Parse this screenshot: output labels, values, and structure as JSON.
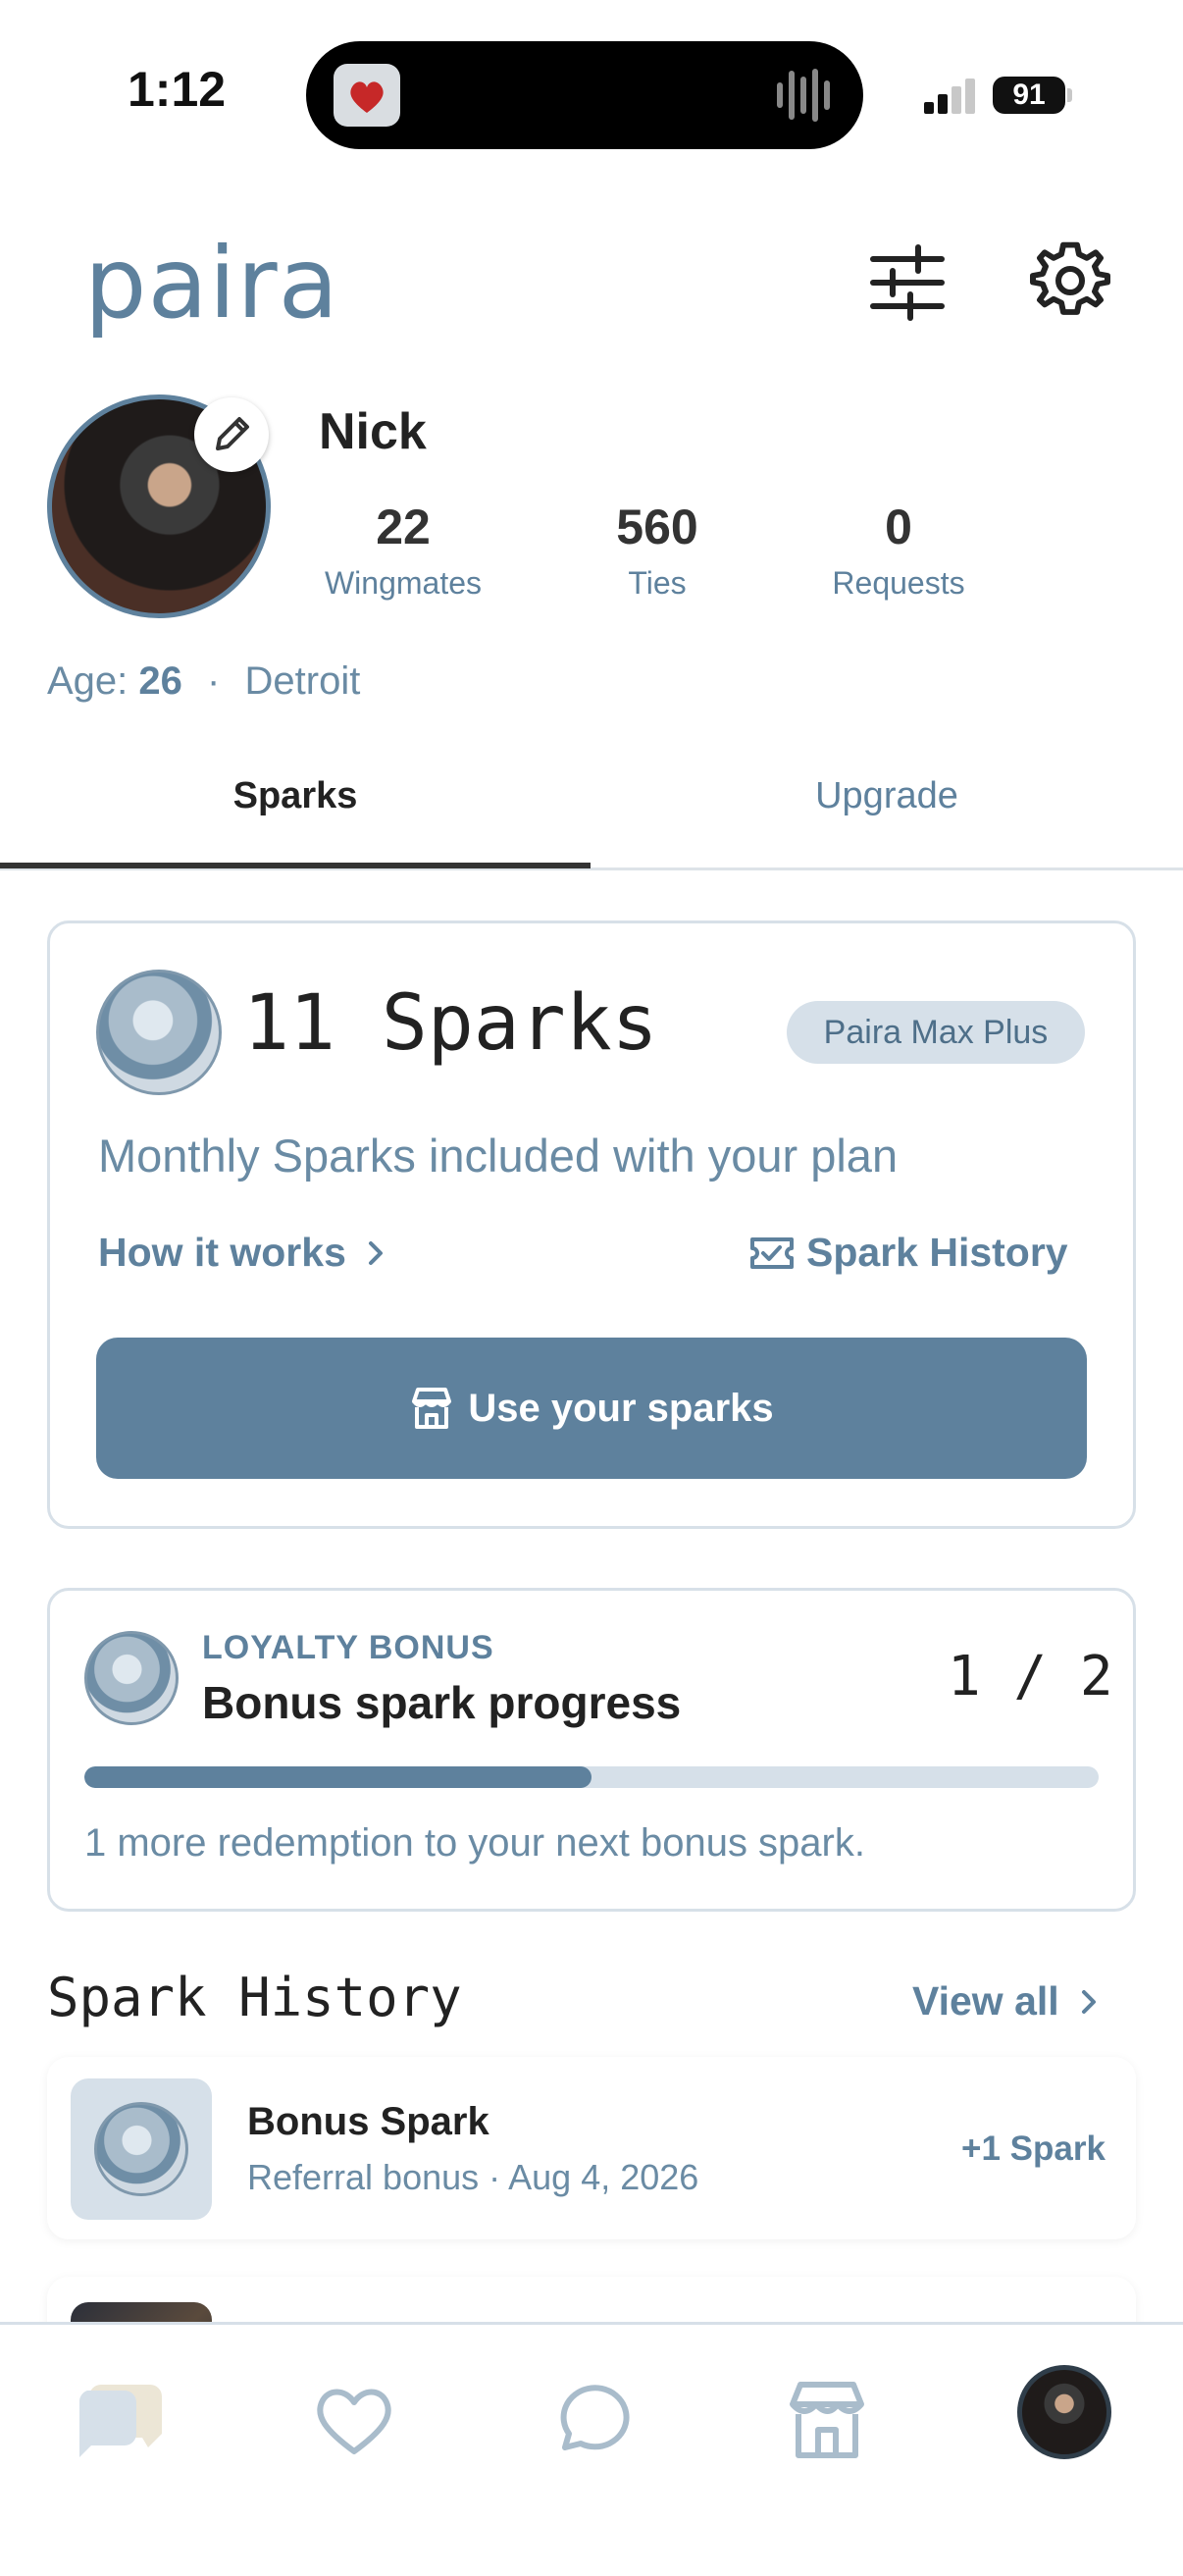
{
  "status_bar": {
    "time": "1:12",
    "battery": "91"
  },
  "header": {
    "logo": "paira"
  },
  "profile": {
    "name": "Nick",
    "stats": [
      {
        "value": "22",
        "label": "Wingmates"
      },
      {
        "value": "560",
        "label": "Ties"
      },
      {
        "value": "0",
        "label": "Requests"
      }
    ],
    "age_label": "Age:",
    "age": "26",
    "separator": "·",
    "city": "Detroit"
  },
  "tabs": [
    {
      "label": "Sparks",
      "active": true
    },
    {
      "label": "Upgrade",
      "active": false
    }
  ],
  "sparks_card": {
    "count_text": "11 Sparks",
    "plan_badge": "Paira Max Plus",
    "description": "Monthly Sparks included with your plan",
    "how_it_works": "How it works",
    "history_link": "Spark History",
    "use_button": "Use your sparks"
  },
  "loyalty": {
    "eyebrow": "LOYALTY BONUS",
    "title": "Bonus spark progress",
    "fraction": "1 / 2",
    "progress": 0.5,
    "note": "1 more redemption to your next bonus spark."
  },
  "history": {
    "title": "Spark History",
    "view_all": "View all",
    "items": [
      {
        "title": "Bonus Spark",
        "subtitle": "Referral bonus · Aug 4, 2026",
        "amount": "+1 Spark"
      }
    ]
  },
  "colors": {
    "accent": "#5e819d",
    "accent_light": "#d6e0e9",
    "text_dark": "#222222"
  },
  "bottom_nav": [
    {
      "icon": "pairs-icon"
    },
    {
      "icon": "heart-icon"
    },
    {
      "icon": "chat-icon"
    },
    {
      "icon": "store-icon"
    },
    {
      "icon": "profile-avatar"
    }
  ]
}
